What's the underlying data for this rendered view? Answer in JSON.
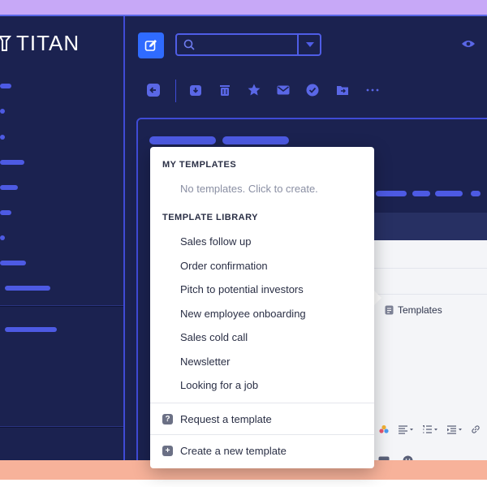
{
  "app": {
    "brand": "TITAN"
  },
  "dropdown": {
    "my_templates_heading": "MY TEMPLATES",
    "my_templates_empty": "No templates. Click to create.",
    "library_heading": "TEMPLATE LIBRARY",
    "library_items": [
      "Sales follow up",
      "Order confirmation",
      "Pitch to potential investors",
      "New employee onboarding",
      "Sales cold call",
      "Newsletter",
      "Looking for a job"
    ],
    "request_label": "Request a template",
    "create_label": "Create a new template"
  },
  "editor": {
    "templates_chip": "Templates"
  },
  "colors": {
    "app_bg": "#1b2250",
    "accent": "#4d5ae3",
    "primary_button": "#2f6bff",
    "top_band": "#c7a8f7",
    "bottom_band": "#f7b29a"
  },
  "icons": {
    "compose": "edit-icon",
    "search": "search-icon",
    "visibility": "eye-icon",
    "toolbar": [
      "back-icon",
      "archive-icon",
      "trash-icon",
      "star-icon",
      "mail-icon",
      "check-icon",
      "move-icon",
      "more-icon"
    ]
  }
}
